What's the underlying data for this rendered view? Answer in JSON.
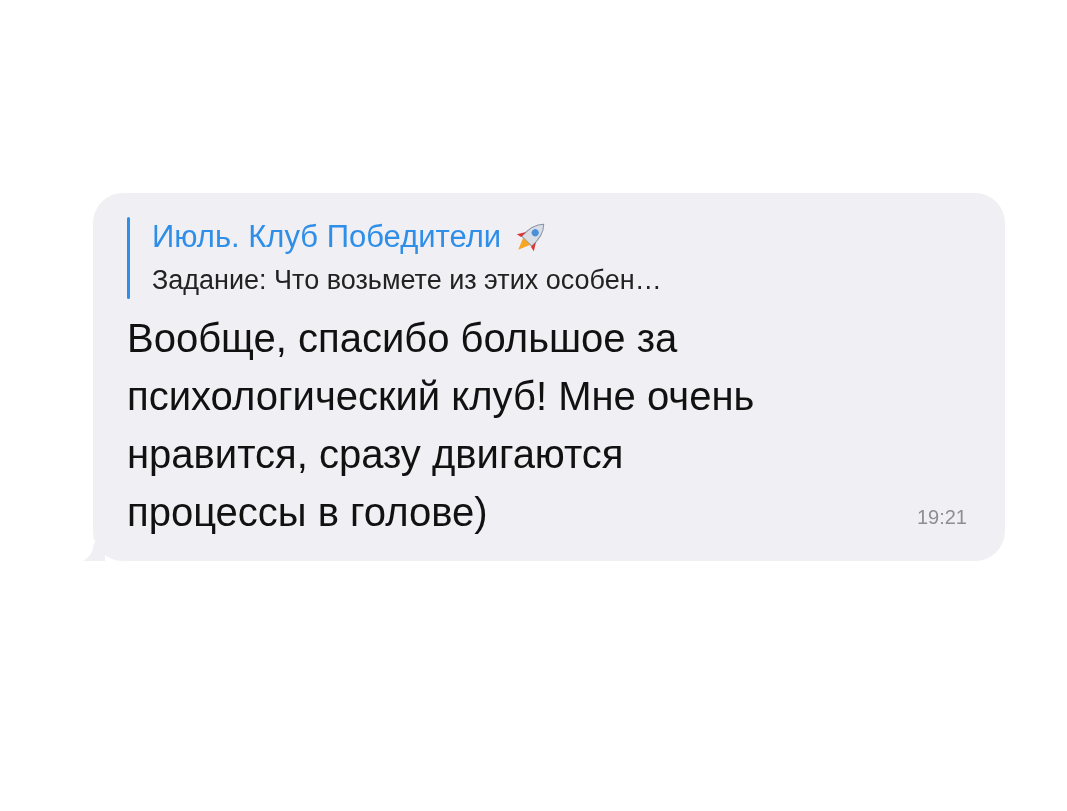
{
  "message": {
    "reply": {
      "title": "Июль. Клуб Победители",
      "excerpt": "Задание: Что возьмете из этих особен…"
    },
    "text": "Вообще, спасибо большое за психологический клуб! Мне очень нравится, сразу двигаются процессы в голове)",
    "time": "19:21"
  }
}
